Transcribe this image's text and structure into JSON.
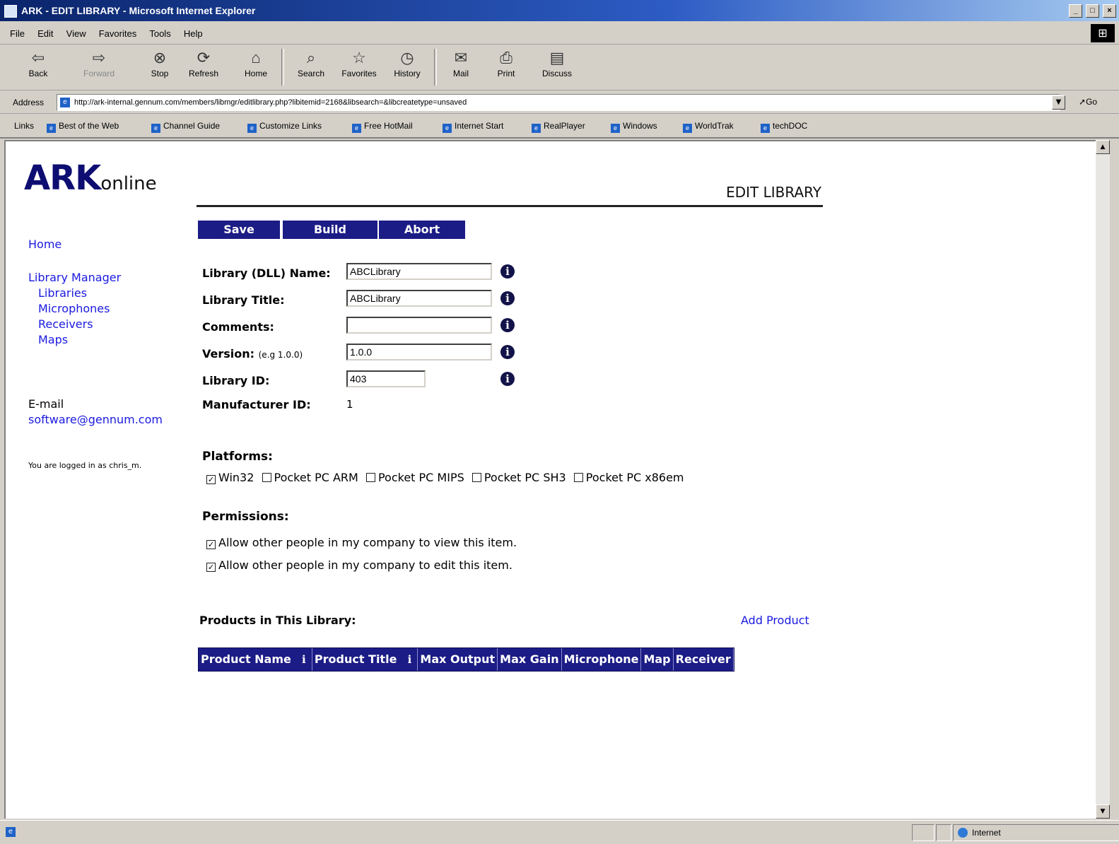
{
  "window": {
    "title": "ARK - EDIT LIBRARY - Microsoft Internet Explorer",
    "controls": [
      "_",
      "□",
      "×"
    ]
  },
  "menu": [
    "File",
    "Edit",
    "View",
    "Favorites",
    "Tools",
    "Help"
  ],
  "toolbar": {
    "buttons": [
      {
        "label": "Back",
        "icon": "back-arrow-icon",
        "glyph": "⇦"
      },
      {
        "label": "Forward",
        "icon": "forward-arrow-icon",
        "glyph": "⇨"
      },
      {
        "label": "Stop",
        "icon": "stop-icon",
        "glyph": "⊗"
      },
      {
        "label": "Refresh",
        "icon": "refresh-icon",
        "glyph": "⟳"
      },
      {
        "label": "Home",
        "icon": "home-icon",
        "glyph": "⌂"
      },
      {
        "label": "Search",
        "icon": "search-icon",
        "glyph": "⌕"
      },
      {
        "label": "Favorites",
        "icon": "favorites-icon",
        "glyph": "☆"
      },
      {
        "label": "History",
        "icon": "history-icon",
        "glyph": "◷"
      },
      {
        "label": "Mail",
        "icon": "mail-icon",
        "glyph": "✉"
      },
      {
        "label": "Print",
        "icon": "print-icon",
        "glyph": "⎙"
      },
      {
        "label": "Discuss",
        "icon": "discuss-icon",
        "glyph": "▤"
      }
    ]
  },
  "address": {
    "label": "Address",
    "url": "http://ark-internal.gennum.com/members/libmgr/editlibrary.php?libitemid=2168&libsearch=&libcreatetype=unsaved",
    "go_label": "Go"
  },
  "links": {
    "label": "Links",
    "items": [
      "Best of the Web",
      "Channel Guide",
      "Customize Links",
      "Free HotMail",
      "Internet Start",
      "RealPlayer",
      "Windows",
      "WorldTrak",
      "techDOC"
    ]
  },
  "page": {
    "logo_big": "ARK",
    "logo_small": "online",
    "title": "EDIT LIBRARY",
    "actions": {
      "save": "Save",
      "build": "Build",
      "abort": "Abort"
    },
    "nav": {
      "home": "Home",
      "library_manager": "Library Manager",
      "libraries": "Libraries",
      "microphones": "Microphones",
      "receivers": "Receivers",
      "maps": "Maps"
    },
    "email_label": "E-mail",
    "email": "software@gennum.com",
    "login_text": "You are logged in as chris_m.",
    "form": {
      "dll_name_label": "Library (DLL) Name:",
      "dll_name_value": "ABCLibrary",
      "title_label": "Library Title:",
      "title_value": "ABCLibrary",
      "comments_label": "Comments:",
      "comments_value": "",
      "version_label": "Version:",
      "version_hint": "(e.g 1.0.0)",
      "version_value": "1.0.0",
      "library_id_label": "Library ID:",
      "library_id_value": "403",
      "manufacturer_label": "Manufacturer ID:",
      "manufacturer_value": "1"
    },
    "platforms_heading": "Platforms:",
    "platforms": [
      {
        "label": "Win32",
        "checked": true
      },
      {
        "label": "Pocket PC ARM",
        "checked": false
      },
      {
        "label": "Pocket PC MIPS",
        "checked": false
      },
      {
        "label": "Pocket PC SH3",
        "checked": false
      },
      {
        "label": "Pocket PC x86em",
        "checked": false
      }
    ],
    "permissions_heading": "Permissions:",
    "permissions": [
      {
        "label": "Allow other people in my company to view this item.",
        "checked": true
      },
      {
        "label": "Allow other people in my company to edit this item.",
        "checked": true
      }
    ],
    "products_heading": "Products in This Library:",
    "add_product": "Add Product",
    "product_columns": [
      "Product Name",
      "Product Title",
      "Max Output",
      "Max Gain",
      "Microphone",
      "Map",
      "Receiver"
    ]
  },
  "status": {
    "zone": "Internet"
  },
  "colors": {
    "accent": "#1c1c86",
    "link": "#1a1ae0",
    "titlebar": "#0a246a",
    "chrome": "#d4d0c8"
  }
}
